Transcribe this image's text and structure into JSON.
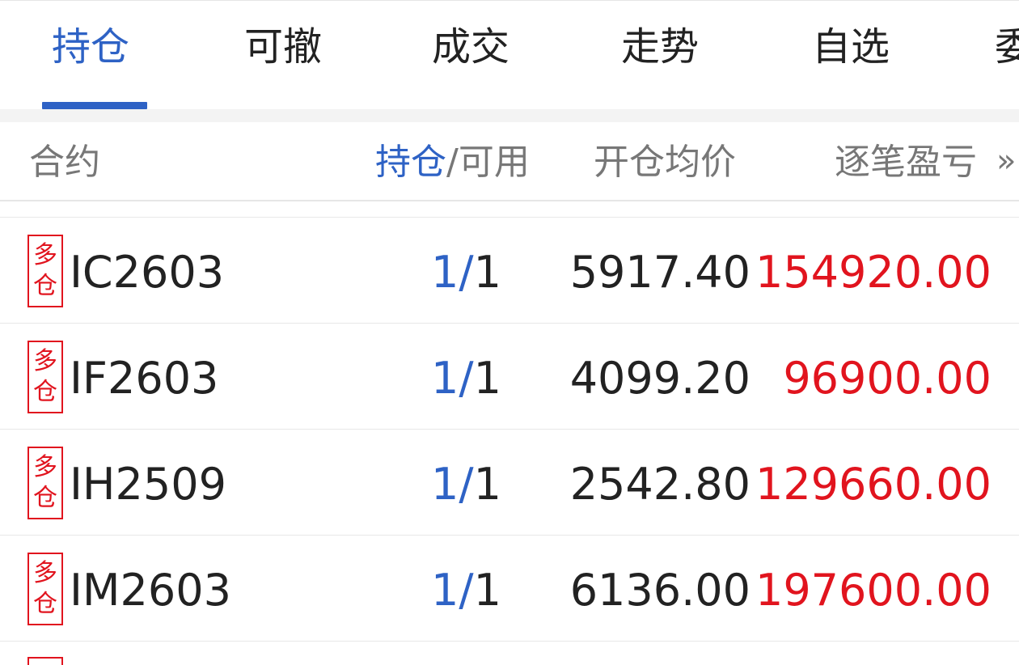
{
  "tabs": {
    "items": [
      {
        "label": "持仓",
        "active": true
      },
      {
        "label": "可撤",
        "active": false
      },
      {
        "label": "成交",
        "active": false
      },
      {
        "label": "走势",
        "active": false
      },
      {
        "label": "自选",
        "active": false
      },
      {
        "label": "委",
        "active": false
      }
    ]
  },
  "table": {
    "headers": {
      "contract": "合约",
      "position_accent": "持仓",
      "position_rest": "/可用",
      "avg_price": "开仓均价",
      "pnl": "逐笔盈亏",
      "more": "»"
    },
    "rows": [
      {
        "badge_top": "多",
        "badge_bottom": "仓",
        "contract": "IC2603",
        "held": "1",
        "slash": "/",
        "available": "1",
        "avg_price": "5917.40",
        "pnl": "154920.00"
      },
      {
        "badge_top": "多",
        "badge_bottom": "仓",
        "contract": "IF2603",
        "held": "1",
        "slash": "/",
        "available": "1",
        "avg_price": "4099.20",
        "pnl": "96900.00"
      },
      {
        "badge_top": "多",
        "badge_bottom": "仓",
        "contract": "IH2509",
        "held": "1",
        "slash": "/",
        "available": "1",
        "avg_price": "2542.80",
        "pnl": "129660.00"
      },
      {
        "badge_top": "多",
        "badge_bottom": "仓",
        "contract": "IM2603",
        "held": "1",
        "slash": "/",
        "available": "1",
        "avg_price": "6136.00",
        "pnl": "197600.00"
      }
    ]
  },
  "colors": {
    "accent": "#2e62c5",
    "profit": "#e1141e",
    "text": "#222222",
    "muted": "#777777"
  }
}
